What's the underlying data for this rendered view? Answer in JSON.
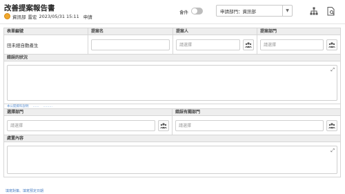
{
  "header": {
    "title": "改善提案報告書",
    "department": "資訊部",
    "user": "雷宏",
    "datetime": "2023/05/31 15:11",
    "status": "申請"
  },
  "toolbar": {
    "toggle_label": "會件",
    "toggle_on": false,
    "dept_select_value": "申請部門：資訊部"
  },
  "form": {
    "form_id_label": "表單編號",
    "form_id_value": "田未經自動產生",
    "proposal_name_label": "提案名",
    "proposer_label": "提案人",
    "proposer_placeholder": "請選擇",
    "proposal_dept_label": "提案部門",
    "proposal_dept_placeholder": "請選擇",
    "error_status_label": "錯誤的狀況",
    "error_links": [
      "本公開資料說明",
      "……",
      "………"
    ],
    "select_dept_label": "選擇部門",
    "select_dept_placeholder": "請選擇",
    "error_related_dept_label": "錯誤有關部門",
    "error_related_dept_placeholder": "請選擇",
    "handling_label": "處置內容"
  },
  "footer": {
    "link_text": "填寫對策、填寫預定日期"
  },
  "colors": {
    "avatar": "#f0a830",
    "link": "#4a7fc4",
    "label_bg": "#eeeeee"
  }
}
